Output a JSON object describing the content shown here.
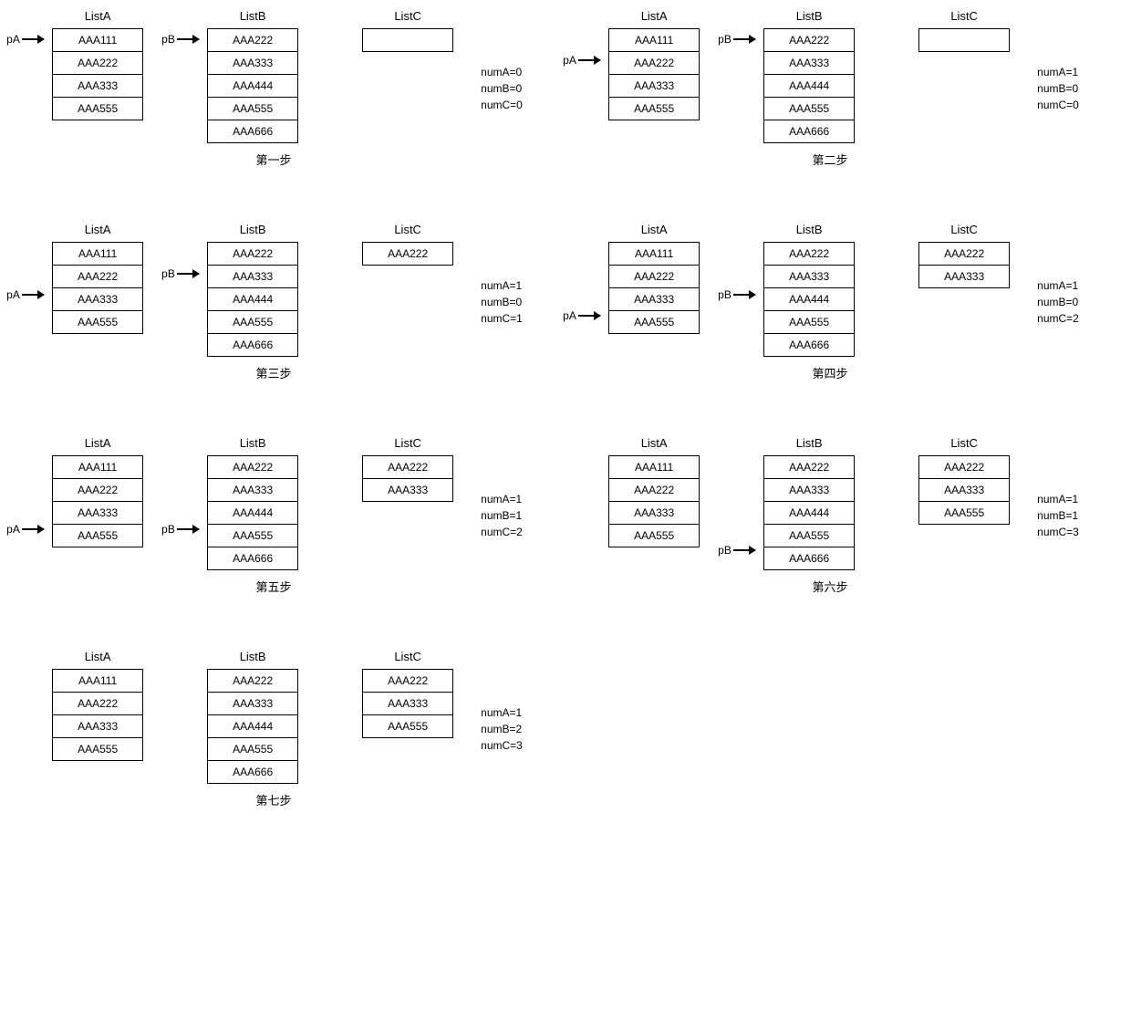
{
  "labels": {
    "listA": "ListA",
    "listB": "ListB",
    "listC": "ListC",
    "pA": "pA",
    "pB": "pB",
    "numA_prefix": "numA=",
    "numB_prefix": "numB=",
    "numC_prefix": "numC="
  },
  "listA_items": [
    "AAA111",
    "AAA222",
    "AAA333",
    "AAA555"
  ],
  "listB_items": [
    "AAA222",
    "AAA333",
    "AAA444",
    "AAA555",
    "AAA666"
  ],
  "steps": [
    {
      "caption": "第一步",
      "pA": 0,
      "pB": 0,
      "listC": [],
      "numA": 0,
      "numB": 0,
      "numC": 0
    },
    {
      "caption": "第二步",
      "pA": 1,
      "pB": 0,
      "listC": [],
      "numA": 1,
      "numB": 0,
      "numC": 0
    },
    {
      "caption": "第三步",
      "pA": 2,
      "pB": 1,
      "listC": [
        "AAA222"
      ],
      "numA": 1,
      "numB": 0,
      "numC": 1
    },
    {
      "caption": "第四步",
      "pA": 3,
      "pB": 2,
      "listC": [
        "AAA222",
        "AAA333"
      ],
      "numA": 1,
      "numB": 0,
      "numC": 2
    },
    {
      "caption": "第五步",
      "pA": 3,
      "pB": 3,
      "listC": [
        "AAA222",
        "AAA333"
      ],
      "numA": 1,
      "numB": 1,
      "numC": 2
    },
    {
      "caption": "第六步",
      "pA": null,
      "pB": 4,
      "listC": [
        "AAA222",
        "AAA333",
        "AAA555"
      ],
      "numA": 1,
      "numB": 1,
      "numC": 3
    },
    {
      "caption": "第七步",
      "pA": null,
      "pB": null,
      "listC": [
        "AAA222",
        "AAA333",
        "AAA555"
      ],
      "numA": 1,
      "numB": 2,
      "numC": 3
    }
  ]
}
